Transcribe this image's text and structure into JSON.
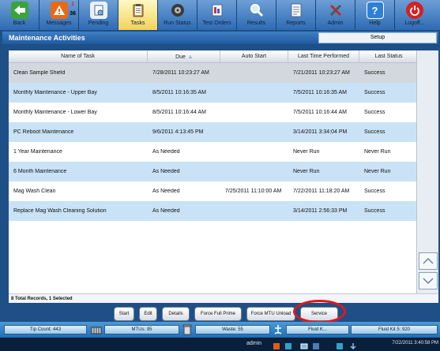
{
  "toolbar": {
    "buttons": [
      {
        "label": "Back",
        "icon": "back-arrow-icon"
      },
      {
        "label": "Messages",
        "icon": "warning-icon",
        "badge_top": "1",
        "badge_bottom": "36"
      },
      {
        "label": "Pending",
        "icon": "pending-icon"
      },
      {
        "label": "Tasks",
        "icon": "clipboard-icon"
      },
      {
        "label": "Run Status",
        "icon": "disc-icon"
      },
      {
        "label": "Test Orders",
        "icon": "test-orders-icon"
      },
      {
        "label": "Results",
        "icon": "magnifier-icon"
      },
      {
        "label": "Reports",
        "icon": "report-icon"
      },
      {
        "label": "Admin",
        "icon": "tools-icon"
      },
      {
        "label": "Help",
        "icon": "help-icon"
      },
      {
        "label": "Logoff...",
        "icon": "power-icon"
      }
    ]
  },
  "panel": {
    "title": "Maintenance Activities",
    "setup_tab": "Setup"
  },
  "table": {
    "columns": [
      "Name of Task",
      "Due",
      "Auto Start",
      "Last Time Performed",
      "Last Status"
    ],
    "rows": [
      {
        "name": "Clean Sample Shield",
        "due": "7/28/2011 10:23:27 AM",
        "auto_start": "",
        "last_time": "7/21/2011 10:23:27 AM",
        "status": "Success"
      },
      {
        "name": "Monthly Maintenance - Upper Bay",
        "due": "8/5/2011 10:16:35 AM",
        "auto_start": "",
        "last_time": "7/5/2011 10:16:35 AM",
        "status": "Success"
      },
      {
        "name": "Monthly Maintenance - Lower Bay",
        "due": "8/5/2011 10:16:44 AM",
        "auto_start": "",
        "last_time": "7/5/2011 10:16:44 AM",
        "status": "Success"
      },
      {
        "name": "PC Reboot Maintenance",
        "due": "9/6/2011 4:13:45 PM",
        "auto_start": "",
        "last_time": "3/14/2011 3:34:04 PM",
        "status": "Success"
      },
      {
        "name": "1 Year Maintenance",
        "due": "As Needed",
        "auto_start": "",
        "last_time": "Never Run",
        "status": "Never Run"
      },
      {
        "name": "6 Month Maintenance",
        "due": "As Needed",
        "auto_start": "",
        "last_time": "Never Run",
        "status": "Never Run"
      },
      {
        "name": "Mag Wash Clean",
        "due": "As Needed",
        "auto_start": "7/25/2011 11:10:00 AM",
        "last_time": "7/22/2011 11:18:20 AM",
        "status": "Success"
      },
      {
        "name": "Replace Mag Wash Cleaning Solution",
        "due": "As Needed",
        "auto_start": "",
        "last_time": "3/14/2011 2:56:33 PM",
        "status": "Success"
      }
    ],
    "footer": "8 Total Records, 1 Selected"
  },
  "actions": {
    "start": "Start",
    "edit": "Edit",
    "details": "Details",
    "force_full_prime": "Force Full Prime",
    "force_mtu_unload": "Force MTU Unload",
    "service": "Service"
  },
  "status": {
    "tip_count": "Tip Count: 443",
    "mtus": "MTUs: 95",
    "waste": "Waste: 55",
    "fluid_kit_4": "Fluid K...",
    "fluid_kit_5": "Fluid Kit 5: 920"
  },
  "taskbar": {
    "user": "admin",
    "clock": "7/22/2011 3:40:58 PM"
  },
  "colors": {
    "highlight": "#e0181e",
    "selected_row": "#d3d8de",
    "alt_row": "#c9e2f6",
    "title_bar": "#2a6ab0"
  }
}
